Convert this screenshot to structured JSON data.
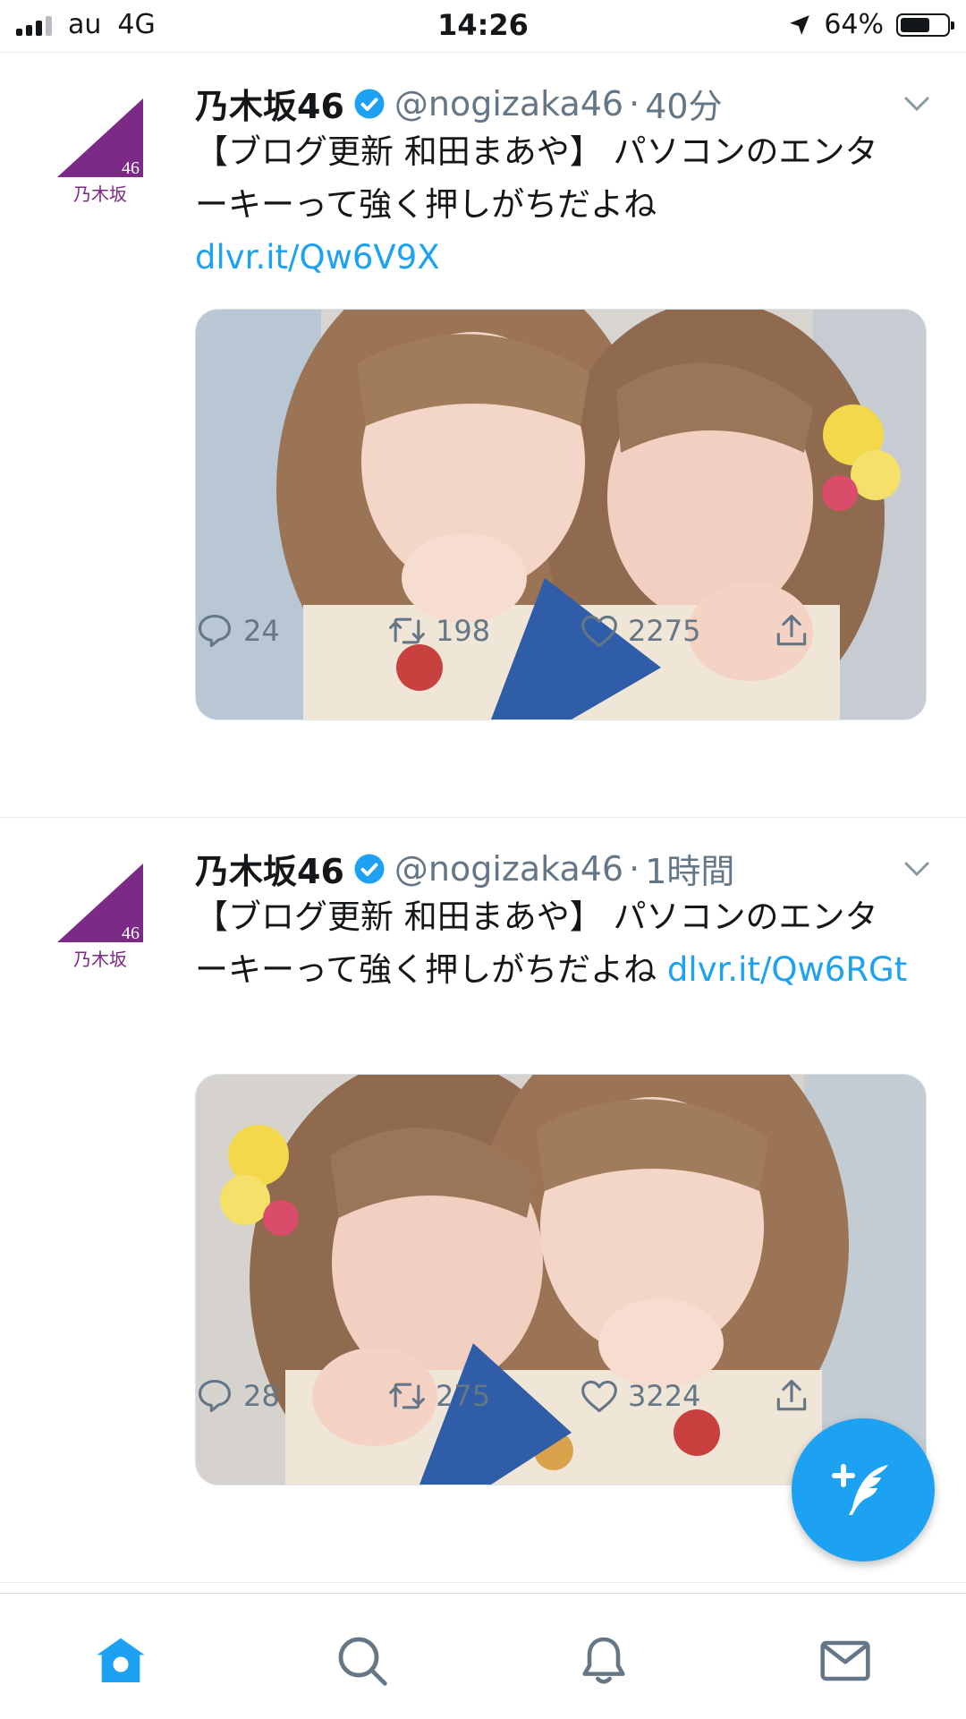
{
  "status_bar": {
    "carrier": "au",
    "network": "4G",
    "time": "14:26",
    "battery": "64%",
    "battery_level": 0.64
  },
  "tweets": [
    {
      "name": "乃木坂46",
      "handle": "@nogizaka46",
      "separator": "·",
      "time": "40分",
      "text": "【ブログ更新 和田まあや】 パソコンのエンターキーって強く押しがちだよね ",
      "link": "dlvr.it/Qw6V9X",
      "avatar_label": "46",
      "avatar_sub": "乃木坂",
      "replies": "24",
      "retweets": "198",
      "likes": "2275"
    },
    {
      "name": "乃木坂46",
      "handle": "@nogizaka46",
      "separator": "·",
      "time": "1時間",
      "text": "【ブログ更新 和田まあや】 パソコンのエンターキーって強く押しがちだよね ",
      "link": "dlvr.it/Qw6RGt",
      "avatar_label": "46",
      "avatar_sub": "乃木坂",
      "replies": "28",
      "retweets": "275",
      "likes": "3224"
    }
  ],
  "icons": {
    "reply": "reply-icon",
    "retweet": "retweet-icon",
    "like": "heart-icon",
    "share": "share-icon",
    "compose": "compose-tweet-icon",
    "tabs": [
      "home-icon",
      "search-icon",
      "notifications-icon",
      "messages-icon"
    ]
  },
  "colors": {
    "accent": "#1da1f2",
    "brand_purple": "#7b2a85",
    "secondary_text": "#657786"
  }
}
